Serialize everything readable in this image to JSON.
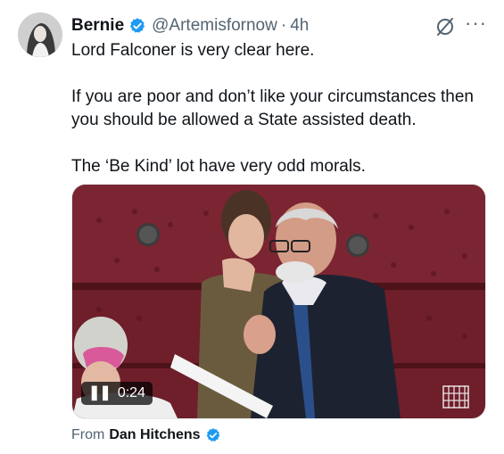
{
  "author": {
    "name": "Bernie",
    "handle": "@Artemisfornow",
    "separator": "·",
    "time": "4h",
    "verified_icon": "verified-badge-icon"
  },
  "tweet": {
    "lines": [
      "Lord Falconer is very clear here.",
      "If you are poor and don’t like your circumstances then you should be allowed a State assisted death.",
      "The ‘Be Kind’ lot have very odd morals."
    ]
  },
  "media": {
    "duration": "0:24",
    "play_state_icon": "pause-icon",
    "watermark_icon": "portcullis-icon"
  },
  "source": {
    "prefix": "From",
    "name": "Dan Hitchens",
    "verified_icon": "verified-badge-icon"
  },
  "actions": {
    "grok_icon": "grok-icon",
    "more_icon": "more-horizontal-icon",
    "more_glyph": "···"
  },
  "colors": {
    "verified_blue": "#1d9bf0",
    "text_primary": "#0f1419",
    "text_secondary": "#536471"
  }
}
